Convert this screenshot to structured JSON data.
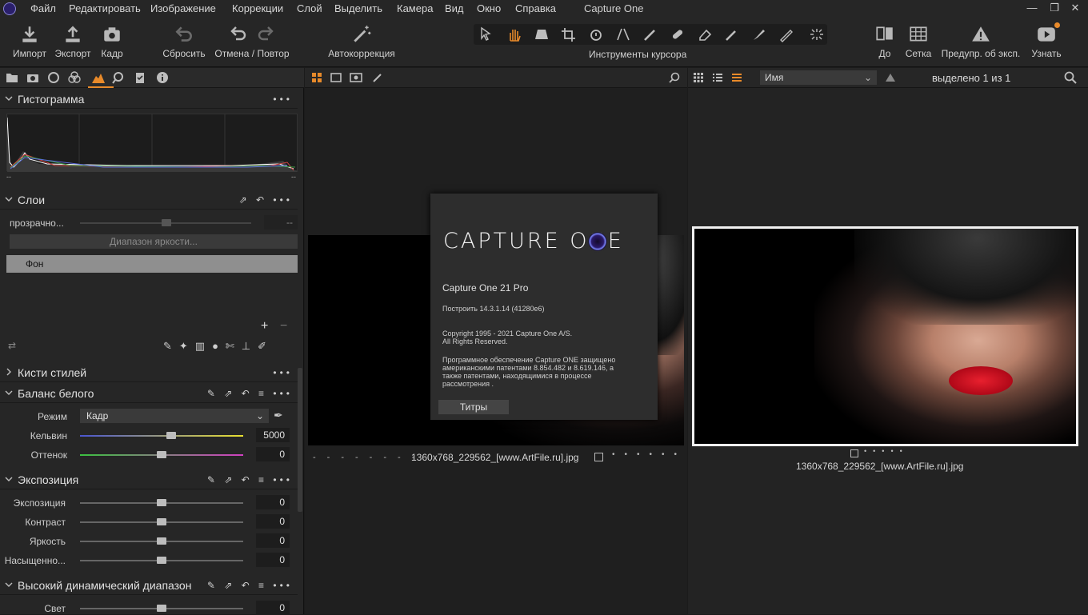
{
  "app": {
    "title": "Capture One"
  },
  "menu": [
    "Файл",
    "Редактировать",
    "Изображение",
    "Коррекции",
    "Слой",
    "Выделить",
    "Камера",
    "Вид",
    "Окно",
    "Справка"
  ],
  "toolbar": {
    "import": "Импорт",
    "export": "Экспорт",
    "capture": "Кадр",
    "reset": "Сбросить",
    "undo_redo": "Отмена / Повтор",
    "auto": "Автокоррекция",
    "cursor_tools": "Инструменты курсора",
    "before": "До",
    "grid": "Сетка",
    "exposure_warning": "Предупр. об эксп.",
    "learn": "Узнать"
  },
  "histogram": {
    "title": "Гистограмма",
    "left_val": "--",
    "right_val": "--"
  },
  "layers": {
    "title": "Слои",
    "opacity_label": "прозрачно...",
    "opacity_value": "--",
    "luma_range": "Диапазон яркости...",
    "background_layer": "Фон"
  },
  "style_brushes": {
    "title": "Кисти стилей"
  },
  "white_balance": {
    "title": "Баланс белого",
    "mode_label": "Режим",
    "mode_value": "Кадр",
    "kelvin_label": "Кельвин",
    "kelvin_value": "5000",
    "tint_label": "Оттенок",
    "tint_value": "0"
  },
  "exposure": {
    "title": "Экспозиция",
    "rows": [
      {
        "label": "Экспозиция",
        "value": "0"
      },
      {
        "label": "Контраст",
        "value": "0"
      },
      {
        "label": "Яркость",
        "value": "0"
      },
      {
        "label": "Насыщенно...",
        "value": "0"
      }
    ]
  },
  "hdr": {
    "title": "Высокий динамический диапазон",
    "light_label": "Свет",
    "light_value": "0"
  },
  "viewer": {
    "meta": [
      "--",
      "--",
      "--",
      "--"
    ],
    "filename": "1360x768_229562_[www.ArtFile.ru].jpg"
  },
  "browser": {
    "sort": "Имя",
    "selected": "выделено 1 из 1",
    "filename": "1360x768_229562_[www.ArtFile.ru].jpg"
  },
  "about": {
    "logo": "CAPTURE ONE",
    "product": "Capture One 21 Pro",
    "build": "Построить 14.3.1.14 (41280e6)",
    "copyright1": "Copyright 1995 - 2021 Capture One A/S.",
    "copyright2": "All Rights Reserved.",
    "patents1": "Программное обеспечение Capture ONE защищено",
    "patents2": "американскими патентами   8.854.482 и 8.619.146, а",
    "patents3": "также патентами, находящимися в процессе",
    "patents4": "рассмотрения .",
    "credits": "Титры"
  },
  "colors": {
    "accent": "#e88a2a",
    "panel": "#262626",
    "background": "#1b1b1b"
  }
}
